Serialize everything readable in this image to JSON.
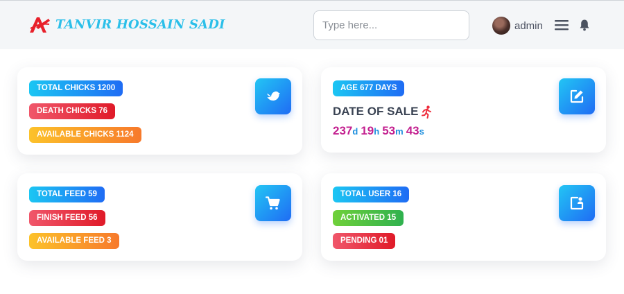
{
  "header": {
    "brand": "TANVIR HOSSAIN SADI",
    "search_placeholder": "Type here...",
    "user_name": "admin"
  },
  "cards": {
    "chicks": {
      "total": "TOTAL CHICKS 1200",
      "death": "DEATH CHICKS 76",
      "available": "AVAILABLE CHICKS 1124",
      "icon": "bird-icon"
    },
    "sale": {
      "age": "AGE 677 DAYS",
      "title": "DATE OF SALE",
      "countdown": {
        "days": "237",
        "days_unit": "d",
        "hours": "19",
        "hours_unit": "h",
        "minutes": "53",
        "minutes_unit": "m",
        "seconds": "43",
        "seconds_unit": "s"
      },
      "icon": "edit-icon"
    },
    "feed": {
      "total": "TOTAL FEED 59",
      "finish": "FINISH FEED 56",
      "available": "AVAILABLE FEED 3",
      "icon": "cart-icon"
    },
    "users": {
      "total": "TOTAL USER 16",
      "activated": "ACTIVATED 15",
      "pending": "PENDING 01",
      "icon": "user-card-icon"
    }
  },
  "colors": {
    "brand": "#2bbfe9",
    "blue": "#1f6cf4",
    "red": "#e01a28",
    "orange": "#f7792b",
    "green": "#2fb14e",
    "countdown_number": "#c31f8f",
    "countdown_unit": "#1d8fde"
  }
}
